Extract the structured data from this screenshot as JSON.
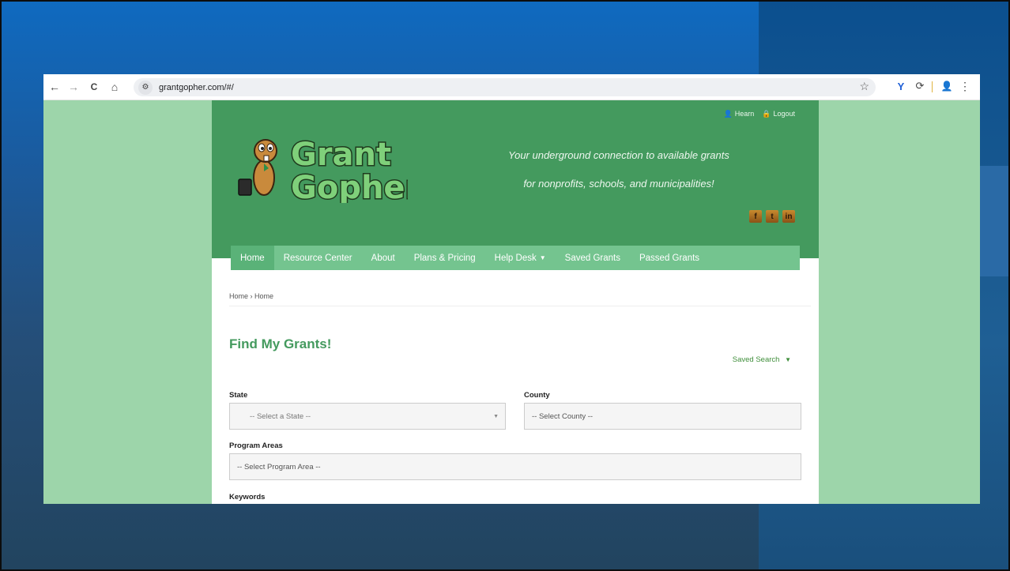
{
  "browser": {
    "url": "grantgopher.com/#/",
    "nav": {
      "back": "←",
      "forward": "→",
      "reload": "C",
      "home": "⌂"
    },
    "site_info_icon": "⚙",
    "star_icon": "☆",
    "extensions": [
      {
        "icon": "Y",
        "color": "#1f5fd6"
      },
      {
        "icon": "⟳",
        "color": "#444444"
      },
      {
        "icon": "👤",
        "color": "#d18a2c"
      },
      {
        "icon": "⋮",
        "color": "#444444"
      }
    ]
  },
  "site": {
    "user_links": {
      "user": "Hearn",
      "logout": "Logout"
    },
    "logo": {
      "line1": "Grant",
      "line2": "Gopher"
    },
    "tagline": {
      "line1": "Your underground connection to available grants",
      "line2": "for nonprofits, schools, and municipalities!"
    },
    "social": [
      "f",
      "t",
      "in"
    ],
    "nav": [
      {
        "label": "Home",
        "active": true
      },
      {
        "label": "Resource Center"
      },
      {
        "label": "About"
      },
      {
        "label": "Plans & Pricing"
      },
      {
        "label": "Help Desk",
        "dropdown": true
      },
      {
        "label": "Saved Grants"
      },
      {
        "label": "Passed Grants"
      }
    ]
  },
  "content": {
    "breadcrumb": "Home › Home",
    "title": "Find My Grants!",
    "saved_search": "Saved Search",
    "form": {
      "state_label": "State",
      "state_value": "-- Select a State --",
      "county_label": "County",
      "county_value": "-- Select County --",
      "program_label": "Program Areas",
      "program_value": "-- Select Program Area --",
      "keywords_label": "Keywords"
    }
  }
}
